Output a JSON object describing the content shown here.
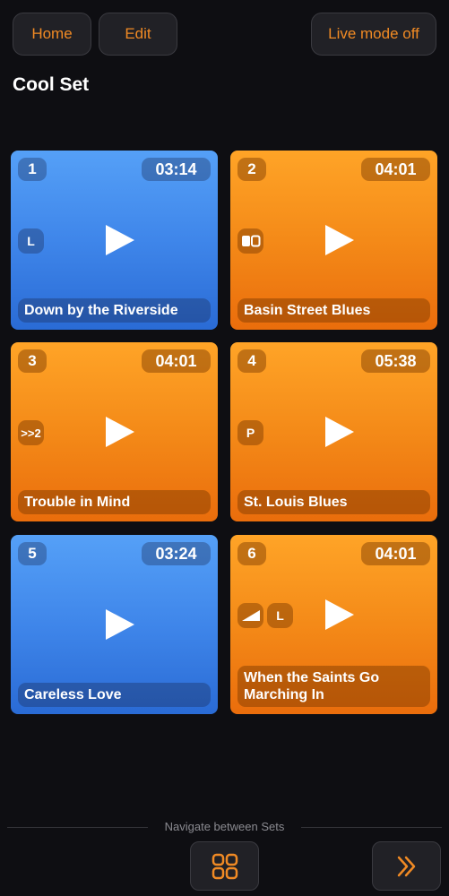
{
  "header": {
    "home_label": "Home",
    "edit_label": "Edit",
    "live_label": "Live mode off"
  },
  "set": {
    "title": "Cool Set"
  },
  "songs": [
    {
      "number": "1",
      "duration": "03:14",
      "name": "Down by the Riverside",
      "color": "blue",
      "flags": [
        "L"
      ]
    },
    {
      "number": "2",
      "duration": "04:01",
      "name": "Basin Street Blues",
      "color": "orange",
      "flags": [
        "pages-icon"
      ]
    },
    {
      "number": "3",
      "duration": "04:01",
      "name": "Trouble in Mind",
      "color": "orange",
      "flags": [
        ">>2"
      ]
    },
    {
      "number": "4",
      "duration": "05:38",
      "name": "St. Louis Blues",
      "color": "orange",
      "flags": [
        "P"
      ]
    },
    {
      "number": "5",
      "duration": "03:24",
      "name": "Careless Love",
      "color": "blue",
      "flags": []
    },
    {
      "number": "6",
      "duration": "04:01",
      "name": "When the Saints Go Marching In",
      "color": "orange",
      "flags": [
        "volume-ramp-icon",
        "L"
      ]
    }
  ],
  "footer": {
    "label": "Navigate between Sets",
    "grid_icon": "grid-icon",
    "next_icon": "double-chevron-right-icon"
  },
  "colors": {
    "accent": "#f08a24",
    "blue_tile": "#3f86ea",
    "orange_tile": "#f48a18",
    "background": "#0e0e12"
  }
}
